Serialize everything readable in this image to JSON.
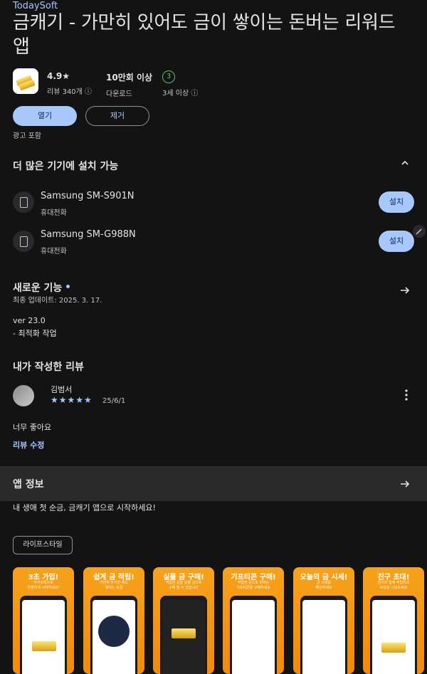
{
  "developer": "TodaySoft",
  "app": {
    "title": "금캐기 - 가만히 있어도 금이 쌓이는 돈버는 리워드 앱",
    "stats": [
      {
        "value": "4.9★",
        "label": "리뷰 340개 ⓘ"
      },
      {
        "value": "10만회 이상",
        "label": "다운로드"
      },
      {
        "value": "3",
        "label": "3세 이상 ⓘ"
      }
    ],
    "open_label": "열기",
    "uninstall_label": "제거",
    "ads_note": "광고 포함"
  },
  "devices": {
    "heading": "더 많은 기기에 설치 가능",
    "items": [
      {
        "name": "Samsung SM-S901N",
        "type": "휴대전화",
        "action": "설치"
      },
      {
        "name": "Samsung SM-G988N",
        "type": "휴대전화",
        "action": "설치"
      }
    ]
  },
  "whats_new": {
    "heading": "새로운 기능",
    "updated": "최종 업데이트: 2025. 3. 17.",
    "version": "ver 23.0",
    "note": "- 최적화 작업"
  },
  "my_review": {
    "heading": "내가 작성한 리뷰",
    "author": "김범서",
    "stars": "★★★★★",
    "date": "25/6/1",
    "text": "너무 좋아요",
    "edit_label": "리뷰 수정"
  },
  "app_info": {
    "heading": "앱 정보",
    "description": "내 생애 첫 순금, 금캐기 앱으로 시작하세요!",
    "tag": "라이프스타일"
  },
  "screenshots": [
    {
      "caption": "3초 가입!",
      "sub": "카카오톡으로\n간편하게 시작하세요!"
    },
    {
      "caption": "쉽게 금 적립!",
      "sub": "가만히 두기만 해도\n쌓이는 순금"
    },
    {
      "caption": "실물 금 구매!",
      "sub": "적립한 금을 실물 금으로\n구매 할 수 있습니다"
    },
    {
      "caption": "기프티콘 구매!",
      "sub": "적립한 금으로 원하는\n기프티콘을 구매하세요"
    },
    {
      "caption": "오늘의 금 시세!",
      "sub": "금 시세를\n확인하세요"
    },
    {
      "caption": "친구 초대!",
      "sub": "친구와 함께 적립하고\n보상을 나눠보세요"
    }
  ],
  "colors": {
    "background": "#131314",
    "accent": "#a8c7fa",
    "screenshot_bg": "#f7a21b"
  }
}
